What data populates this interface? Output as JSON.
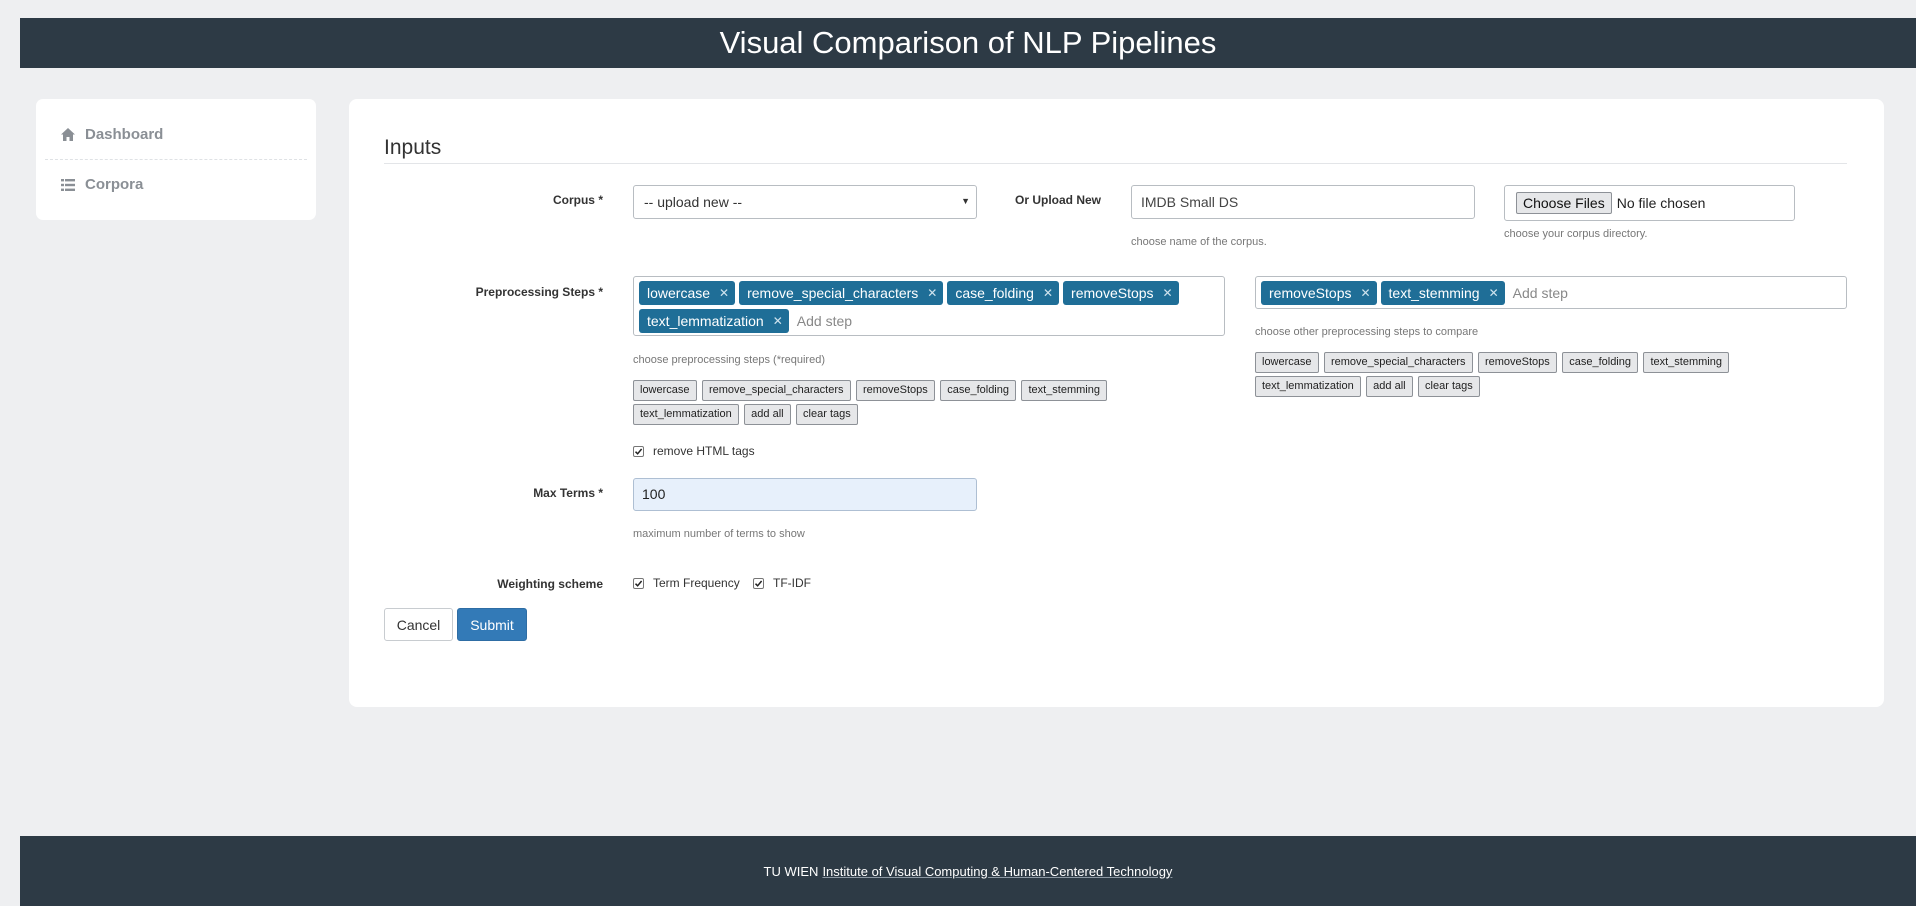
{
  "header": {
    "title": "Visual Comparison of NLP Pipelines"
  },
  "sidebar": {
    "items": [
      {
        "label": "Dashboard",
        "icon": "home-icon"
      },
      {
        "label": "Corpora",
        "icon": "list-icon"
      }
    ]
  },
  "form": {
    "section_title": "Inputs",
    "corpus": {
      "label": "Corpus *",
      "selected": "-- upload new --"
    },
    "upload_new": {
      "label": "Or Upload New",
      "value": "IMDB Small DS",
      "help": "choose name of the corpus."
    },
    "file": {
      "button": "Choose Files",
      "status": "No file chosen",
      "help": "choose your corpus directory."
    },
    "preprocessing": {
      "label": "Preprocessing Steps *",
      "primary_tags": [
        "lowercase",
        "remove_special_characters",
        "case_folding",
        "removeStops",
        "text_lemmatization"
      ],
      "primary_placeholder": "Add step",
      "primary_help": "choose preprocessing steps (*required)",
      "primary_buttons": [
        "lowercase",
        "remove_special_characters",
        "removeStops",
        "case_folding",
        "text_stemming",
        "text_lemmatization",
        "add all",
        "clear tags"
      ],
      "compare_tags": [
        "removeStops",
        "text_stemming"
      ],
      "compare_placeholder": "Add step",
      "compare_help": "choose other preprocessing steps to compare",
      "compare_buttons": [
        "lowercase",
        "remove_special_characters",
        "removeStops",
        "case_folding",
        "text_stemming",
        "text_lemmatization",
        "add all",
        "clear tags"
      ]
    },
    "remove_html": {
      "label": "remove HTML tags",
      "checked": true
    },
    "max_terms": {
      "label": "Max Terms *",
      "value": "100",
      "help": "maximum number of terms to show"
    },
    "weighting": {
      "label": "Weighting scheme",
      "options": [
        {
          "label": "Term Frequency",
          "checked": true
        },
        {
          "label": "TF-IDF",
          "checked": true
        }
      ]
    },
    "cancel_label": "Cancel",
    "submit_label": "Submit"
  },
  "footer": {
    "org": "TU WIEN",
    "link": "Institute of Visual Computing & Human-Centered Technology"
  }
}
